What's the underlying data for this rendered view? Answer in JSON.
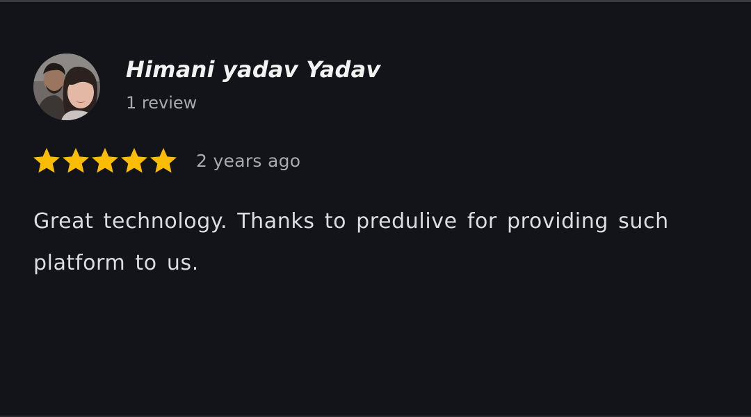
{
  "review": {
    "reviewer_name": "Himani yadav Yadav",
    "review_count": "1 review",
    "rating": 5,
    "max_rating": 5,
    "timestamp": "2 years ago",
    "text": "Great technology. Thanks to predulive for providing such platform to us."
  },
  "icons": {
    "star": "star-icon",
    "avatar": "avatar"
  },
  "colors": {
    "background": "#131419",
    "star": "#fbbc04",
    "name": "#f2f2f2",
    "secondary_text": "#a9aab0",
    "body_text": "#dcdde2"
  }
}
